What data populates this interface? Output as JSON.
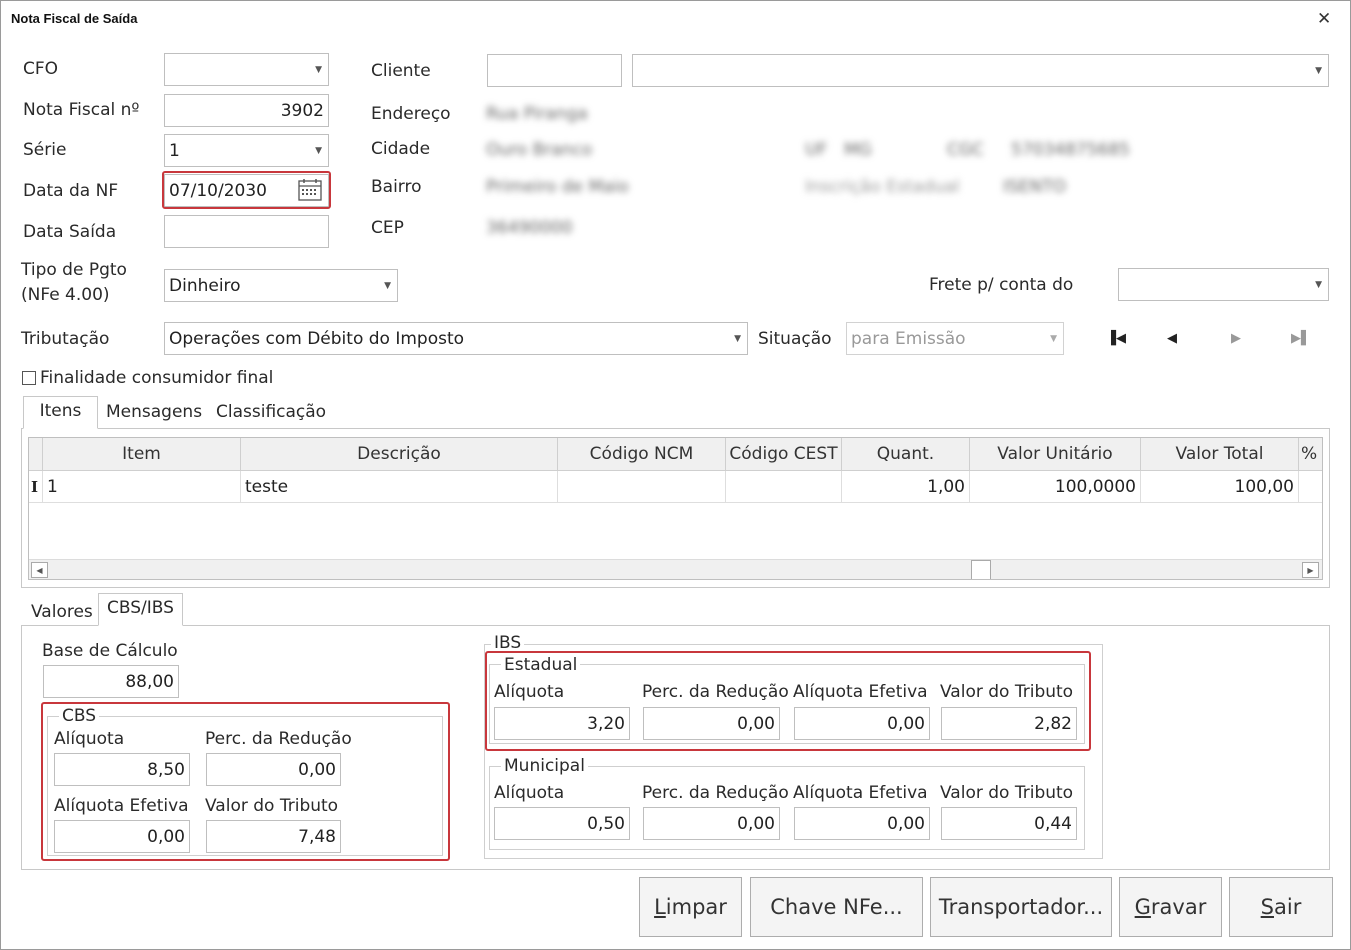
{
  "window": {
    "title": "Nota Fiscal de Saída"
  },
  "labels": {
    "cfo": "CFO",
    "nota_fiscal": "Nota Fiscal nº",
    "serie": "Série",
    "data_nf": "Data da NF",
    "data_saida": "Data Saída",
    "tipo_pgto_1": "Tipo de Pgto",
    "tipo_pgto_2": "(NFe 4.00)",
    "tributacao": "Tributação",
    "cliente": "Cliente",
    "endereco": "Endereço",
    "cidade": "Cidade",
    "bairro": "Bairro",
    "cep": "CEP",
    "frete": "Frete p/ conta do",
    "situacao": "Situação",
    "finalidade": "Finalidade consumidor final"
  },
  "values": {
    "cfo": "",
    "nota_fiscal": "3902",
    "serie": "1",
    "data_nf": "07/10/2030",
    "data_saida": "",
    "tipo_pgto": "Dinheiro",
    "tributacao": "Operações com Débito do Imposto",
    "cliente_code": "",
    "cliente_name": "",
    "frete": "",
    "situacao": "para Emissão"
  },
  "client_info": {
    "endereco": "Rua Piranga",
    "cidade": "Ouro Branco",
    "uf_label": "UF",
    "uf": "MG",
    "cgc_label": "CGC",
    "cgc": "57034875685",
    "bairro": "Primeiro de Maio",
    "ie_label": "Inscrição Estadual",
    "ie": "ISENTO",
    "cep": "36490000"
  },
  "tabs_top": [
    "Itens",
    "Mensagens",
    "Classificação"
  ],
  "grid": {
    "columns": [
      "Item",
      "Descrição",
      "Código NCM",
      "Código CEST",
      "Quant.",
      "Valor Unitário",
      "Valor Total",
      "% IPI"
    ],
    "rows": [
      {
        "marker": "I",
        "item": "1",
        "descricao": "teste",
        "ncm": "",
        "cest": "",
        "quant": "1,00",
        "valor_unitario": "100,0000",
        "valor_total": "100,00"
      }
    ]
  },
  "tabs_bottom": [
    "Valores",
    "CBS/IBS"
  ],
  "cbs_ibs": {
    "base_label": "Base de Cálculo",
    "base": "88,00",
    "cbs": {
      "title": "CBS",
      "aliquota_label": "Alíquota",
      "aliquota": "8,50",
      "reducao_label": "Perc. da Redução",
      "reducao": "0,00",
      "efetiva_label": "Alíquota Efetiva",
      "efetiva": "0,00",
      "tributo_label": "Valor do Tributo",
      "tributo": "7,48"
    },
    "ibs": {
      "title": "IBS",
      "estadual": {
        "title": "Estadual",
        "aliquota_label": "Alíquota",
        "aliquota": "3,20",
        "reducao_label": "Perc. da Redução",
        "reducao": "0,00",
        "efetiva_label": "Alíquota Efetiva",
        "efetiva": "0,00",
        "tributo_label": "Valor do Tributo",
        "tributo": "2,82"
      },
      "municipal": {
        "title": "Municipal",
        "aliquota_label": "Alíquota",
        "aliquota": "0,50",
        "reducao_label": "Perc. da Redução",
        "reducao": "0,00",
        "efetiva_label": "Alíquota Efetiva",
        "efetiva": "0,00",
        "tributo_label": "Valor do Tributo",
        "tributo": "0,44"
      }
    }
  },
  "buttons": {
    "limpar_u": "L",
    "limpar_rest": "impar",
    "chave": "Chave NFe...",
    "transportador": "Transportador...",
    "gravar_u": "G",
    "gravar_rest": "ravar",
    "sair_u": "S",
    "sair_rest": "air"
  },
  "icons": {
    "close": "close-icon",
    "calendar": "calendar-icon",
    "dropdown": "chevron-down-icon",
    "nav": [
      "first-icon",
      "prev-icon",
      "next-icon",
      "last-icon"
    ]
  },
  "colors": {
    "highlight": "#c8373c",
    "border": "#bfbfbf"
  }
}
